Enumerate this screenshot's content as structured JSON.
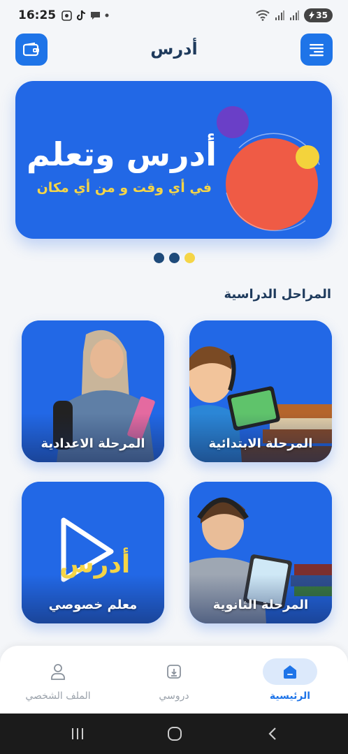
{
  "status": {
    "time": "16:25",
    "battery": "35",
    "left_icons": [
      "screenshot-icon",
      "tiktok-icon",
      "chat-icon",
      "dot-icon"
    ],
    "right_icons": [
      "wifi-icon",
      "signal-icon",
      "signal-icon"
    ]
  },
  "app_bar": {
    "title": "أدرس",
    "left_icon": "wallet-icon",
    "right_icon": "menu-icon"
  },
  "banner": {
    "title": "أدرس وتعلم",
    "subtitle": "في أي وقت و من أي مكان"
  },
  "carousel": {
    "page_count": 3,
    "active_index": 2
  },
  "section": {
    "title": "المراحل الدراسية"
  },
  "stages": [
    {
      "label": "المرحلة الابتدائية"
    },
    {
      "label": "المرحلة الاعدادية"
    },
    {
      "label": "المرحلة الثانوية"
    },
    {
      "label": "معلم خصوصي",
      "logo_text": "أدرس"
    }
  ],
  "bottom_nav": {
    "items": [
      {
        "label": "الرئيسية",
        "icon": "home-icon",
        "active": true
      },
      {
        "label": "دروسي",
        "icon": "lessons-icon",
        "active": false
      },
      {
        "label": "الملف الشخصي",
        "icon": "profile-icon",
        "active": false
      }
    ]
  },
  "colors": {
    "primary": "#1e74e8",
    "banner_blue": "#2268e6",
    "accent_yellow": "#f5d547",
    "dot_dark": "#1e4a7a",
    "title_navy": "#1e3a5c"
  }
}
